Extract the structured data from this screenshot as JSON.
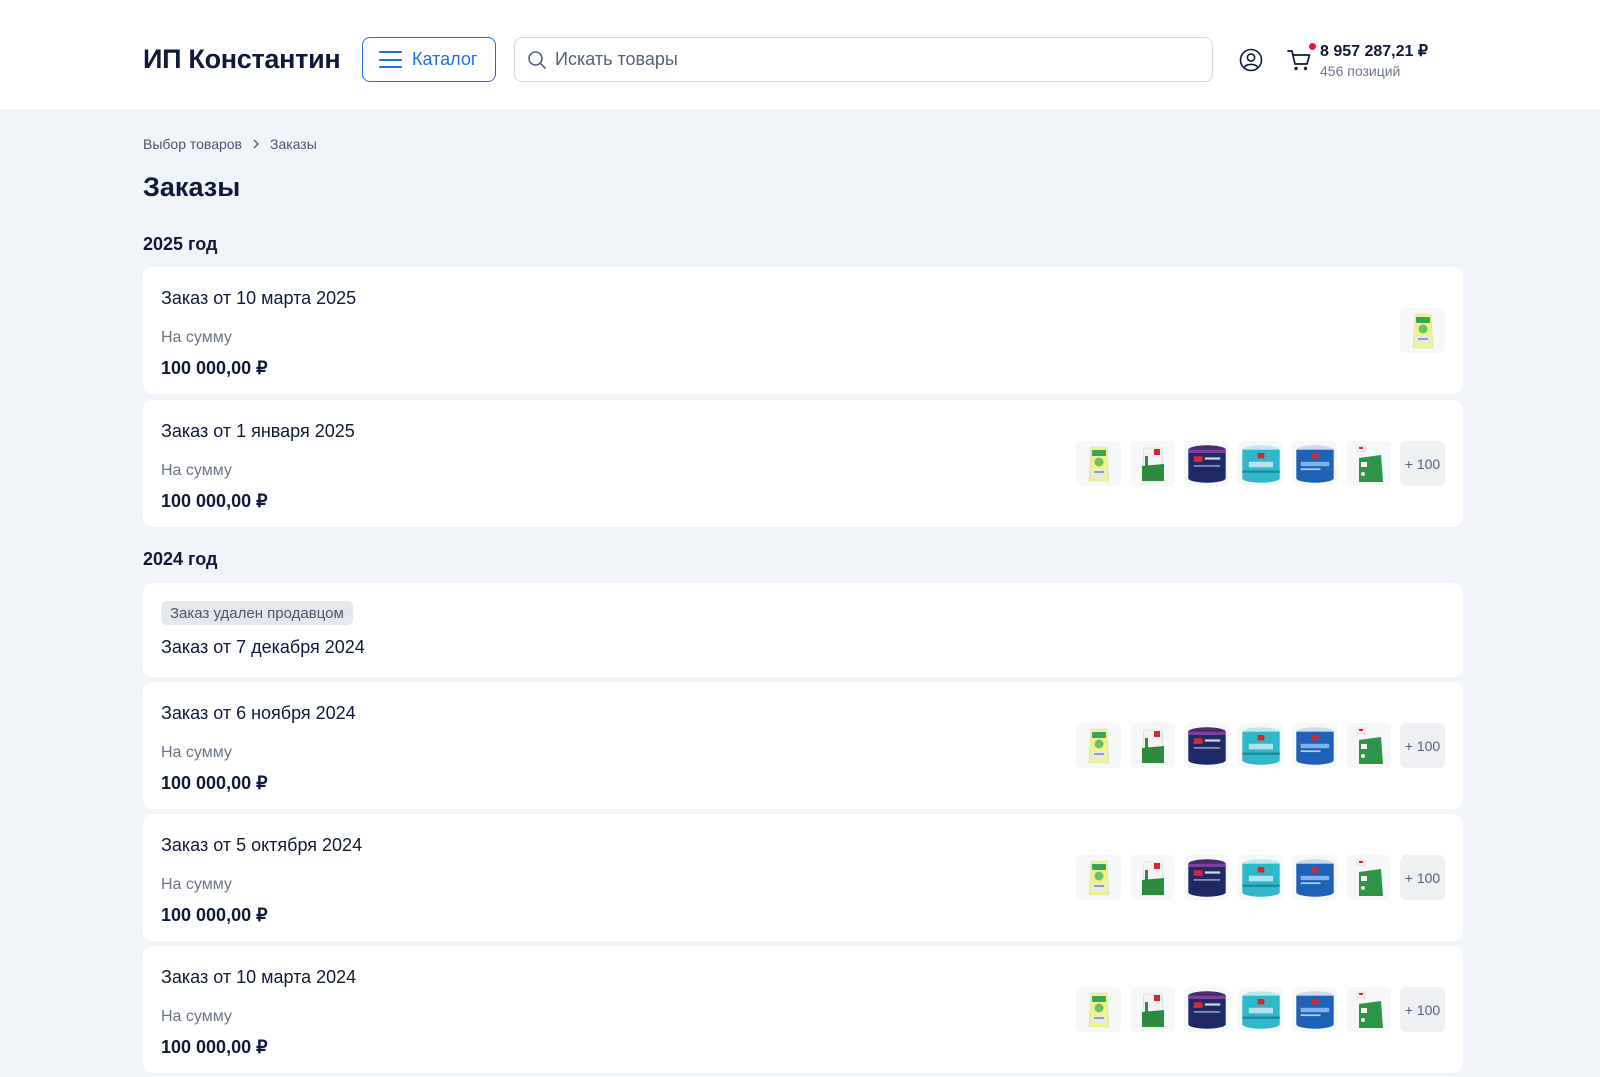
{
  "header": {
    "brand": "ИП Константин",
    "catalog_label": "Каталог",
    "search_placeholder": "Искать товары",
    "cart_sum": "8 957 287,21 ₽",
    "cart_count": "456 позиций",
    "colors": {
      "accent": "#1f6fd6",
      "cart_dot": "#e5173f"
    }
  },
  "breadcrumb": [
    "Выбор товаров",
    "Заказы"
  ],
  "page_title": "Заказы",
  "years": [
    "2025 год",
    "2024 год"
  ],
  "orders": [
    {
      "title": "Заказ от 10 марта 2025",
      "sum_label": "На сумму",
      "sum": "100 000,00 ₽"
    },
    {
      "title": "Заказ от 1 января 2025",
      "sum_label": "На сумму",
      "sum": "100 000,00 ₽",
      "more": "+ 100"
    },
    {
      "badge": "Заказ удален продавцом",
      "title": "Заказ от 7 декабря 2024"
    },
    {
      "title": "Заказ от 6 ноября 2024",
      "sum_label": "На сумму",
      "sum": "100 000,00 ₽",
      "more": "+ 100"
    },
    {
      "title": "Заказ от 5 октября 2024",
      "sum_label": "На сумму",
      "sum": "100 000,00 ₽",
      "more": "+ 100"
    },
    {
      "title": "Заказ от 10 марта 2024",
      "sum_label": "На сумму",
      "sum": "100 000,00 ₽",
      "more": "+ 100"
    }
  ],
  "product_icons": [
    "bag-product-icon",
    "sack-product-icon",
    "paint-can-navy-icon",
    "paint-can-teal-icon",
    "paint-can-blue-icon",
    "grout-bag-product-icon"
  ]
}
